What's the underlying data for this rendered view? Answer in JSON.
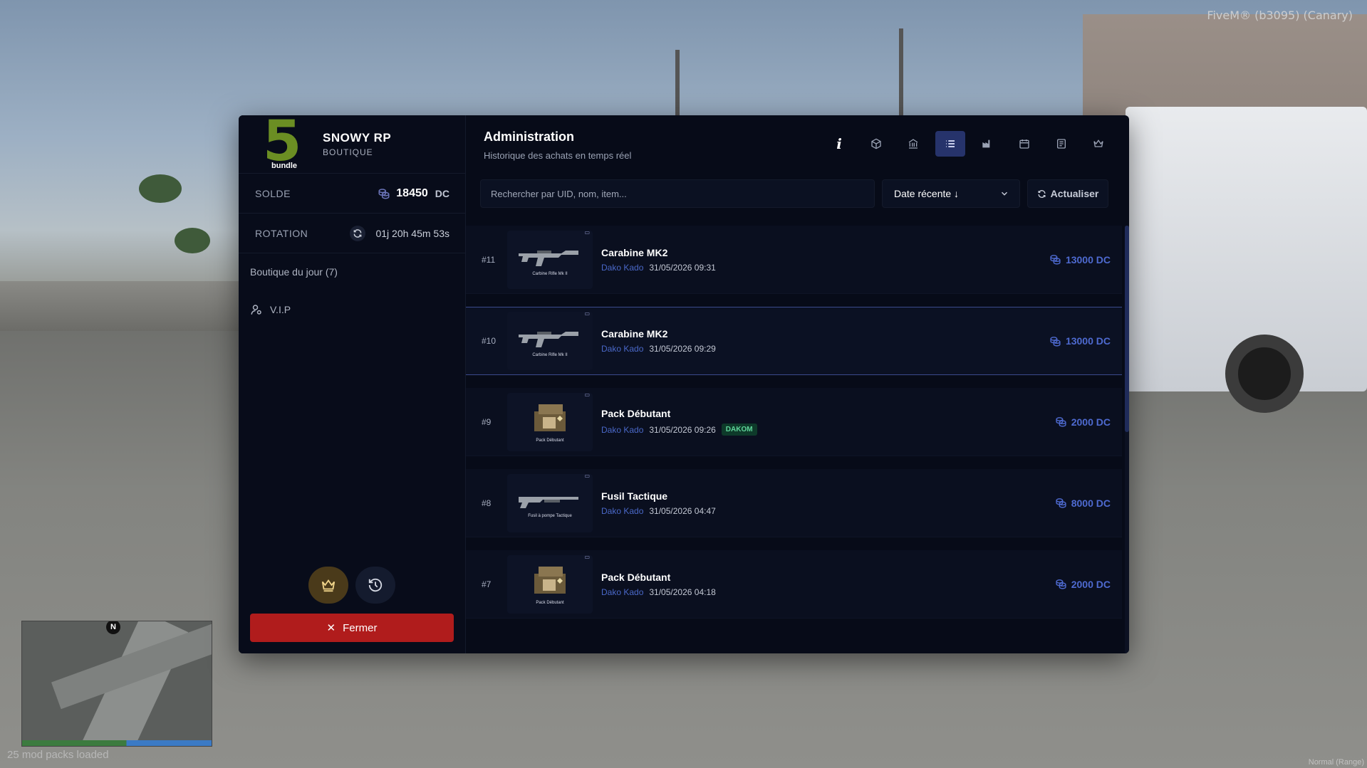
{
  "window": {
    "title": "FiveM® (b3095) (Canary)",
    "status": "Normal (Range)",
    "mods_loaded": "25 mod packs loaded"
  },
  "brand": {
    "logo_number": "5",
    "logo_tag": "bundle",
    "name": "SNOWY RP",
    "subtitle": "BOUTIQUE"
  },
  "sidebar": {
    "balance_label": "SOLDE",
    "balance_value": "18450",
    "balance_unit": "DC",
    "rotation_label": "ROTATION",
    "rotation_value": "01j 20h 45m 53s",
    "shop_of_day": "Boutique du jour (7)",
    "vip": "V.I.P",
    "close_label": "Fermer"
  },
  "main": {
    "title": "Administration",
    "subtitle": "Historique des achats en temps réel",
    "search_placeholder": "Rechercher par UID, nom, item...",
    "sort_label": "Date récente ↓",
    "refresh_label": "Actualiser"
  },
  "purchases": [
    {
      "id": "#11",
      "name": "Carabine MK2",
      "buyer": "Dako Kado",
      "date": "31/05/2026 09:31",
      "price": "13000 DC",
      "caption": "Carbine Rifle Mk II",
      "tag": ""
    },
    {
      "id": "#10",
      "name": "Carabine MK2",
      "buyer": "Dako Kado",
      "date": "31/05/2026 09:29",
      "price": "13000 DC",
      "caption": "Carbine Rifle Mk II",
      "tag": ""
    },
    {
      "id": "#9",
      "name": "Pack Débutant",
      "buyer": "Dako Kado",
      "date": "31/05/2026 09:26",
      "price": "2000 DC",
      "caption": "Pack Débutant",
      "tag": "DAKOM"
    },
    {
      "id": "#8",
      "name": "Fusil Tactique",
      "buyer": "Dako Kado",
      "date": "31/05/2026 04:47",
      "price": "8000 DC",
      "caption": "Fusil à pompe Tactique",
      "tag": ""
    },
    {
      "id": "#7",
      "name": "Pack Débutant",
      "buyer": "Dako Kado",
      "date": "31/05/2026 04:18",
      "price": "2000 DC",
      "caption": "Pack Débutant",
      "tag": ""
    }
  ],
  "colors": {
    "accent": "#26336b",
    "logo": "#6b8e23",
    "close": "#b01c1c",
    "price": "#4e6ad0"
  }
}
